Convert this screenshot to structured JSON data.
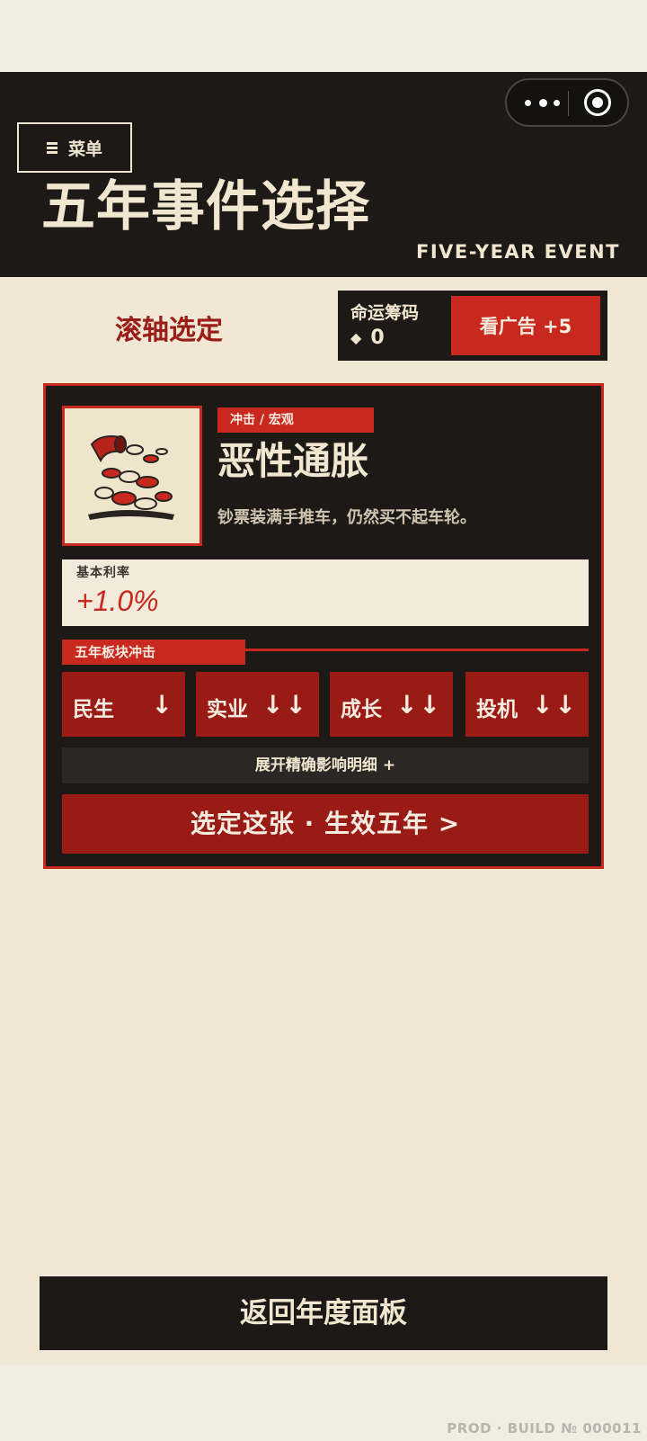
{
  "header": {
    "menu_label": "菜单",
    "title": "五年事件选择",
    "subtitle": "FIVE-YEAR EVENT"
  },
  "toolbar": {
    "scroll_label": "滚轴选定",
    "chips_label": "命运筹码",
    "chips_value": "0",
    "watch_ad_label": "看广告 +5"
  },
  "event": {
    "tag": "冲击 / 宏观",
    "title": "恶性通胀",
    "description": "钞票装满手推车，仍然买不起车轮。",
    "rate_label": "基本利率",
    "rate_value": "+1.0%",
    "impact_label": "五年板块冲击",
    "sectors": [
      {
        "name": "民生",
        "arrows": "↓"
      },
      {
        "name": "实业",
        "arrows": "↓↓"
      },
      {
        "name": "成长",
        "arrows": "↓↓"
      },
      {
        "name": "投机",
        "arrows": "↓↓"
      }
    ],
    "expand_label": "展开精确影响明细  +",
    "select_label": "选定这张 · 生效五年  >"
  },
  "footer": {
    "back_label": "返回年度面板",
    "build": "PROD · BUILD № 000011"
  },
  "colors": {
    "accent_red": "#c9281e",
    "dark_red": "#9a1b16",
    "dark": "#1c1916",
    "cream": "#f0e7d4"
  }
}
